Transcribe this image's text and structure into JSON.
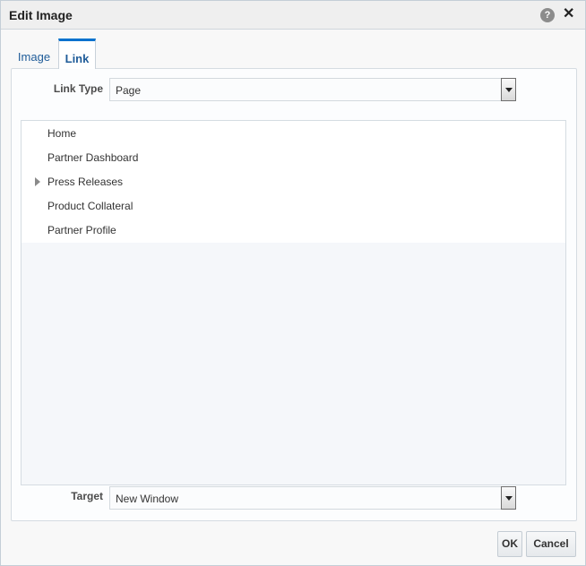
{
  "dialog": {
    "title": "Edit Image",
    "help_icon_glyph": "?",
    "close_icon_glyph": "✕"
  },
  "tabs": [
    {
      "label": "Image",
      "selected": false
    },
    {
      "label": "Link",
      "selected": true
    }
  ],
  "link_type": {
    "label": "Link Type",
    "value": "Page"
  },
  "tree": {
    "items": [
      {
        "label": "Home",
        "expandable": false
      },
      {
        "label": "Partner Dashboard",
        "expandable": false
      },
      {
        "label": "Press Releases",
        "expandable": true
      },
      {
        "label": "Product Collateral",
        "expandable": false
      },
      {
        "label": "Partner Profile",
        "expandable": false
      }
    ]
  },
  "target": {
    "label": "Target",
    "value": "New Window"
  },
  "buttons": {
    "ok": "OK",
    "cancel": "Cancel"
  }
}
